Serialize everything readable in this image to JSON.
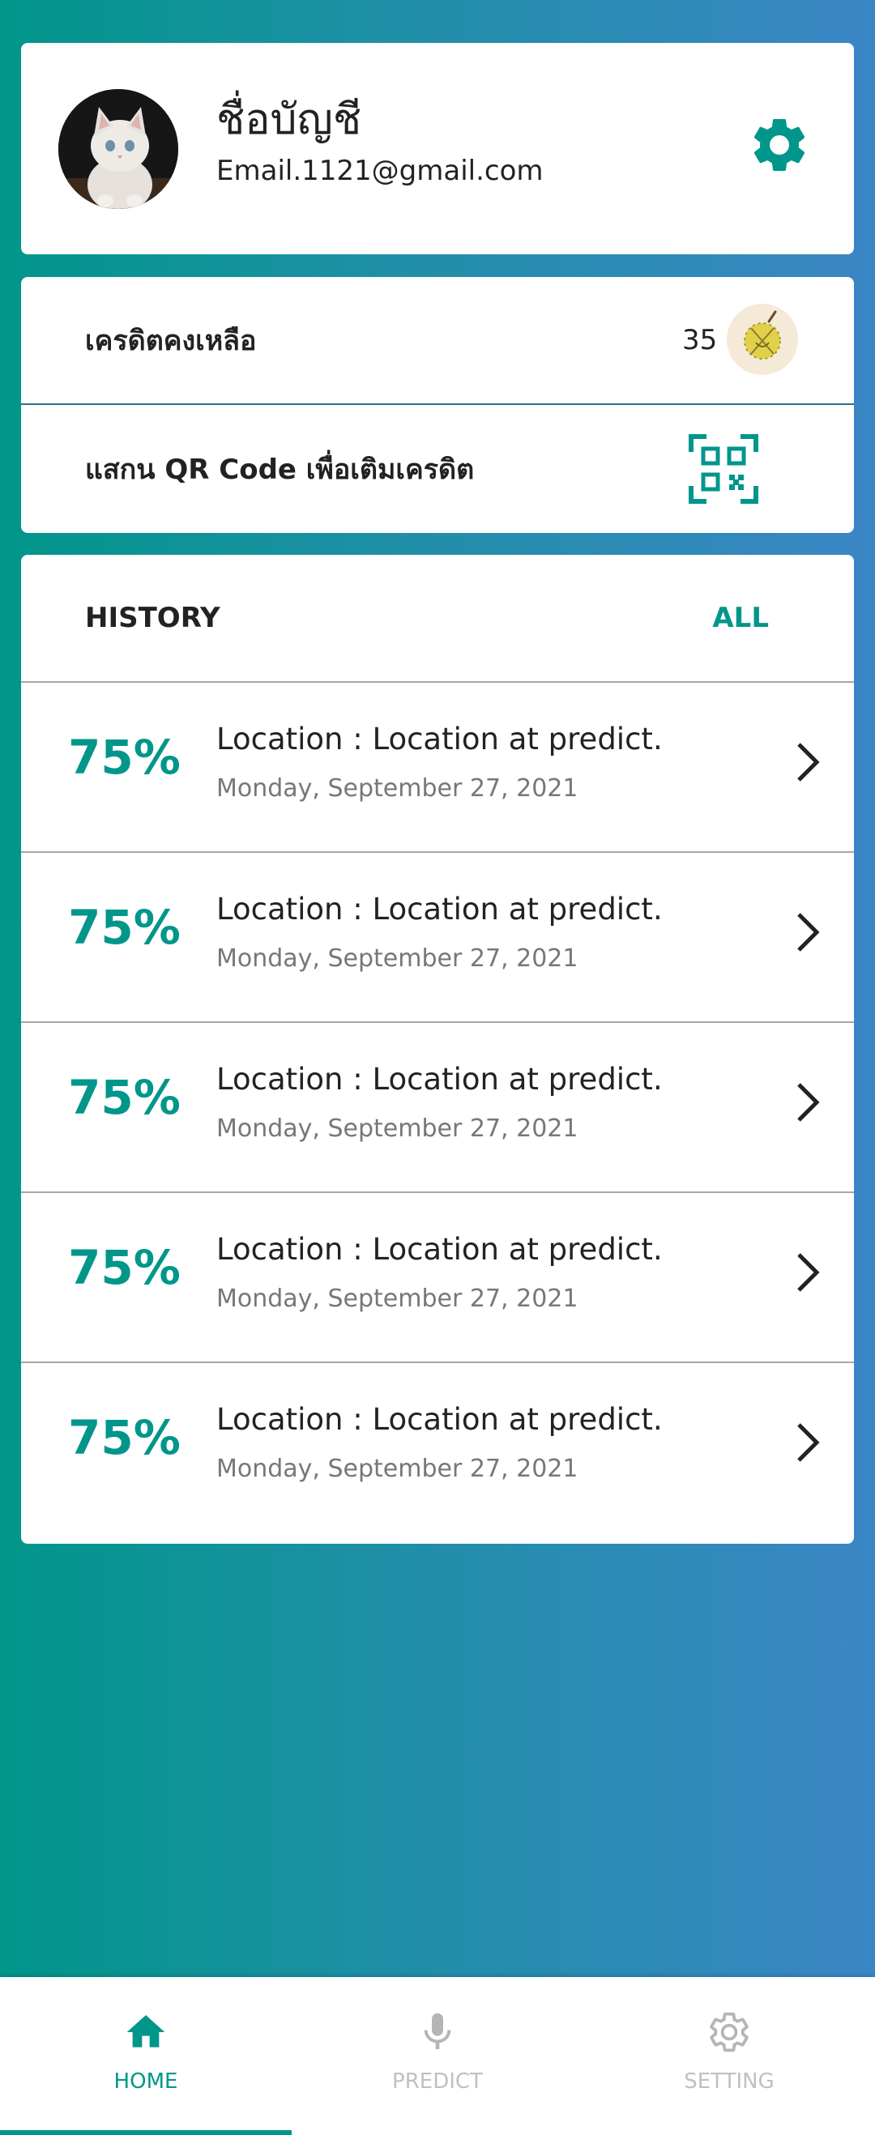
{
  "profile": {
    "account_name": "ชื่อบัญชี",
    "email": "Email.1121@gmail.com",
    "avatar_icon": "cat-avatar-icon",
    "settings_icon": "gear-icon"
  },
  "credit": {
    "remaining_label": "เครดิตคงเหลือ",
    "remaining_value": "35",
    "coin_icon": "durian-coin-icon",
    "scan_label": "แสกน QR Code เพื่อเติมเครดิต",
    "qr_icon": "qr-scan-icon"
  },
  "history": {
    "title": "HISTORY",
    "all_link": "ALL",
    "items": [
      {
        "percent": "75%",
        "location": "Location : Location at predict.",
        "date": "Monday, September 27, 2021"
      },
      {
        "percent": "75%",
        "location": "Location : Location at predict.",
        "date": "Monday, September 27, 2021"
      },
      {
        "percent": "75%",
        "location": "Location : Location at predict.",
        "date": "Monday, September 27, 2021"
      },
      {
        "percent": "75%",
        "location": "Location : Location at predict.",
        "date": "Monday, September 27, 2021"
      },
      {
        "percent": "75%",
        "location": "Location : Location at predict.",
        "date": "Monday, September 27, 2021"
      }
    ]
  },
  "nav": {
    "items": [
      {
        "label": "HOME",
        "icon": "home-icon",
        "active": true
      },
      {
        "label": "PREDICT",
        "icon": "microphone-icon",
        "active": false
      },
      {
        "label": "SETTING",
        "icon": "gear-icon",
        "active": false
      }
    ]
  },
  "colors": {
    "accent": "#01968a",
    "gradient_start": "#01968a",
    "gradient_end": "#3b86c5"
  }
}
